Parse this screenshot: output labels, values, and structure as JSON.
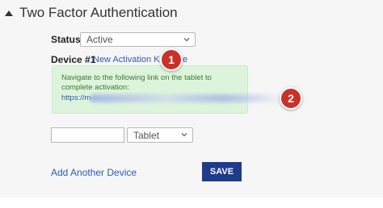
{
  "section": {
    "title": "Two Factor Authentication"
  },
  "status": {
    "label": "Status",
    "value": "Active"
  },
  "device": {
    "label": "Device #1",
    "activation_link": "New Activation Keys",
    "remove_link_visible": "e"
  },
  "info_box": {
    "text": "Navigate to the following link on the tablet to complete activation:",
    "url_prefix": "https://m-"
  },
  "new_device": {
    "name_value": "",
    "type_value": "Tablet"
  },
  "actions": {
    "add_device": "Add Another Device",
    "save": "SAVE"
  },
  "callouts": {
    "badge_1": "1",
    "badge_2": "2"
  },
  "colors": {
    "link": "#2a5db0",
    "save_button": "#1f3b8a",
    "info_bg": "#def3dc",
    "info_text": "#3b7a35",
    "badge": "#c8322a"
  },
  "icons": {
    "section_toggle": "caret-up-icon",
    "dropdown": "chevron-down-icon"
  }
}
